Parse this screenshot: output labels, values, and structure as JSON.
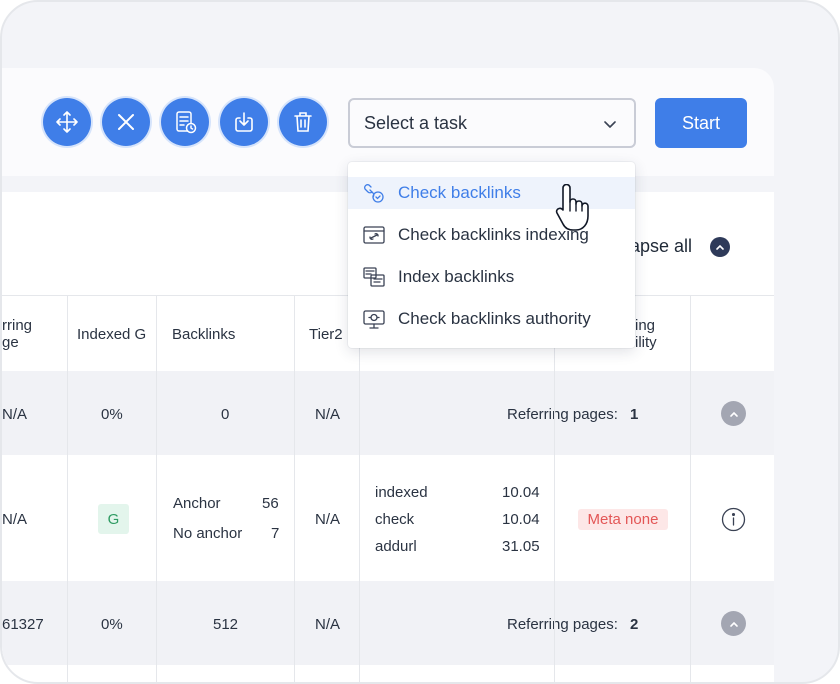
{
  "toolbar": {
    "buttons": [
      {
        "name": "move-icon"
      },
      {
        "name": "close-icon"
      },
      {
        "name": "report-icon"
      },
      {
        "name": "download-icon"
      },
      {
        "name": "trash-icon"
      }
    ],
    "task_select": {
      "value": "Select a task"
    },
    "start_label": "Start"
  },
  "dropdown": {
    "items": [
      {
        "label": "Check backlinks",
        "icon": "link-check-icon",
        "active": true
      },
      {
        "label": "Check backlinks indexing",
        "icon": "browser-link-icon",
        "active": false
      },
      {
        "label": "Index backlinks",
        "icon": "index-pages-icon",
        "active": false
      },
      {
        "label": "Check backlinks authority",
        "icon": "monitor-check-icon",
        "active": false
      }
    ]
  },
  "collapse_all_label": "llapse all",
  "table": {
    "headers": {
      "referring_page": "rring\nge",
      "indexed_g": "Indexed G",
      "backlinks": "Backlinks",
      "tier2": "Tier2",
      "spam_col": "ing\nility"
    },
    "group1": {
      "referring": "N/A",
      "indexed": "0%",
      "backlinks": "0",
      "tier2": "N/A",
      "referring_pages_label": "Referring pages:",
      "referring_pages_count": "1"
    },
    "detail": {
      "referring": "N/A",
      "indexed_badge": "G",
      "anchor_label": "Anchor",
      "anchor_count": "56",
      "no_anchor_label": "No anchor",
      "no_anchor_count": "7",
      "tier2": "N/A",
      "statuses": [
        {
          "label": "indexed",
          "date": "10.04"
        },
        {
          "label": "check",
          "date": "10.04"
        },
        {
          "label": "addurl",
          "date": "31.05"
        }
      ],
      "meta_badge": "Meta none"
    },
    "group2": {
      "referring": "61327",
      "indexed": "0%",
      "backlinks": "512",
      "tier2": "N/A",
      "referring_pages_label": "Referring pages:",
      "referring_pages_count": "2"
    }
  }
}
